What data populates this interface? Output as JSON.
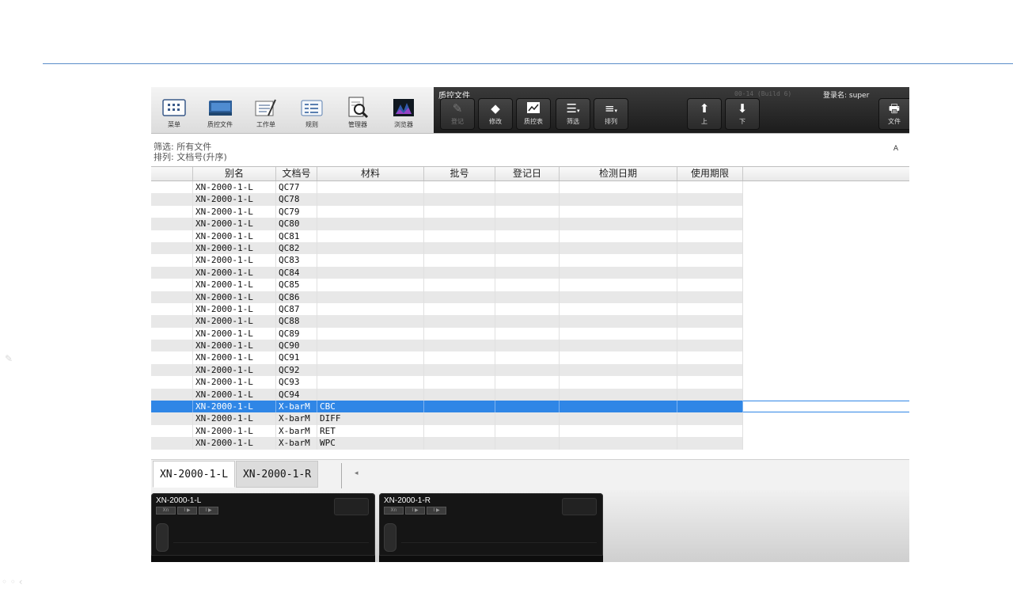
{
  "toolbar": {
    "left_buttons": [
      {
        "label": "菜单",
        "icon": "menu-grid-icon"
      },
      {
        "label": "质控文件",
        "icon": "qc-file-icon"
      },
      {
        "label": "工作单",
        "icon": "worksheet-icon"
      },
      {
        "label": "规则",
        "icon": "rules-icon"
      },
      {
        "label": "管理器",
        "icon": "manager-icon"
      },
      {
        "label": "浏览器",
        "icon": "browser-icon"
      }
    ],
    "section_title": "质控文件",
    "build": "00-14 (Build 6)",
    "login_label": "登录名:",
    "login_user": "super",
    "register_label": "登记",
    "modify_label": "修改",
    "qc_chart_label": "质控表",
    "filter_label": "筛选",
    "sort_label": "排列",
    "up_label": "上",
    "down_label": "下",
    "file_label": "文件"
  },
  "filter_info": {
    "filter_text": "筛选: 所有文件",
    "sort_text": "排列: 文档号(升序)",
    "corner": "A"
  },
  "table": {
    "headers": [
      "",
      "别名",
      "文档号",
      "材料",
      "批号",
      "登记日",
      "检测日期",
      "使用期限"
    ],
    "rows": [
      [
        "",
        "XN-2000-1-L",
        "QC77",
        "",
        "",
        "",
        "",
        ""
      ],
      [
        "",
        "XN-2000-1-L",
        "QC78",
        "",
        "",
        "",
        "",
        ""
      ],
      [
        "",
        "XN-2000-1-L",
        "QC79",
        "",
        "",
        "",
        "",
        ""
      ],
      [
        "",
        "XN-2000-1-L",
        "QC80",
        "",
        "",
        "",
        "",
        ""
      ],
      [
        "",
        "XN-2000-1-L",
        "QC81",
        "",
        "",
        "",
        "",
        ""
      ],
      [
        "",
        "XN-2000-1-L",
        "QC82",
        "",
        "",
        "",
        "",
        ""
      ],
      [
        "",
        "XN-2000-1-L",
        "QC83",
        "",
        "",
        "",
        "",
        ""
      ],
      [
        "",
        "XN-2000-1-L",
        "QC84",
        "",
        "",
        "",
        "",
        ""
      ],
      [
        "",
        "XN-2000-1-L",
        "QC85",
        "",
        "",
        "",
        "",
        ""
      ],
      [
        "",
        "XN-2000-1-L",
        "QC86",
        "",
        "",
        "",
        "",
        ""
      ],
      [
        "",
        "XN-2000-1-L",
        "QC87",
        "",
        "",
        "",
        "",
        ""
      ],
      [
        "",
        "XN-2000-1-L",
        "QC88",
        "",
        "",
        "",
        "",
        ""
      ],
      [
        "",
        "XN-2000-1-L",
        "QC89",
        "",
        "",
        "",
        "",
        ""
      ],
      [
        "",
        "XN-2000-1-L",
        "QC90",
        "",
        "",
        "",
        "",
        ""
      ],
      [
        "",
        "XN-2000-1-L",
        "QC91",
        "",
        "",
        "",
        "",
        ""
      ],
      [
        "",
        "XN-2000-1-L",
        "QC92",
        "",
        "",
        "",
        "",
        ""
      ],
      [
        "",
        "XN-2000-1-L",
        "QC93",
        "",
        "",
        "",
        "",
        ""
      ],
      [
        "",
        "XN-2000-1-L",
        "QC94",
        "",
        "",
        "",
        "",
        ""
      ],
      [
        "",
        "XN-2000-1-L",
        "X-barM",
        "CBC",
        "",
        "",
        "",
        ""
      ],
      [
        "",
        "XN-2000-1-L",
        "X-barM",
        "DIFF",
        "",
        "",
        "",
        ""
      ],
      [
        "",
        "XN-2000-1-L",
        "X-barM",
        "RET",
        "",
        "",
        "",
        ""
      ],
      [
        "",
        "XN-2000-1-L",
        "X-barM",
        "WPC",
        "",
        "",
        "",
        ""
      ]
    ],
    "selected_row": 18
  },
  "tabs": [
    "XN-2000-1-L",
    "XN-2000-1-R"
  ],
  "tab_arrow": "◂",
  "monitors": [
    {
      "name": "XN-2000-1-L",
      "chips": [
        "Xn",
        "I ▶",
        "I ▶"
      ]
    },
    {
      "name": "XN-2000-1-R",
      "chips": [
        "Xn",
        "I ▶",
        "I ▶"
      ]
    }
  ],
  "colors": {
    "selection": "#2f86e6",
    "toolbar_dark": "#2a2a2a",
    "divider_line": "#5b8ec9"
  }
}
